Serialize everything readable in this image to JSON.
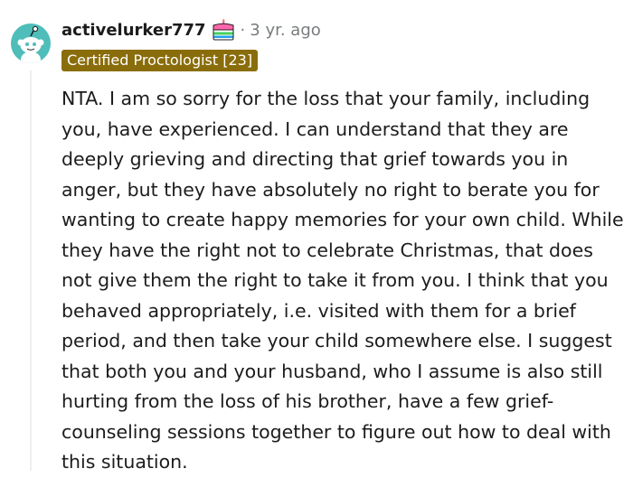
{
  "comment": {
    "username": "activelurker777",
    "separator": "·",
    "timestamp": "3 yr. ago",
    "flair": "Certified Proctologist [23]",
    "body": "NTA. I am so sorry for the loss that your family, including you, have experienced. I can understand that they are deeply grieving and directing that grief towards you in anger, but they have absolutely no right to berate you for wanting to create happy memories for your own child. While they have the right not to celebrate Christmas, that does not give them the right to take it from you. I think that you behaved appropriately, i.e. visited with them for a brief period, and then take your child somewhere else. I suggest that both you and your husband, who I assume is also still hurting from the loss of his brother, have a few grief-counseling sessions together to figure out how to deal with this situation."
  },
  "icons": {
    "avatar": "snoo-avatar",
    "cake_day": "cake-icon"
  },
  "colors": {
    "avatar_bg": "#4fbdba",
    "flair_bg": "#8a6d0b",
    "meta_text": "#787c7e"
  }
}
